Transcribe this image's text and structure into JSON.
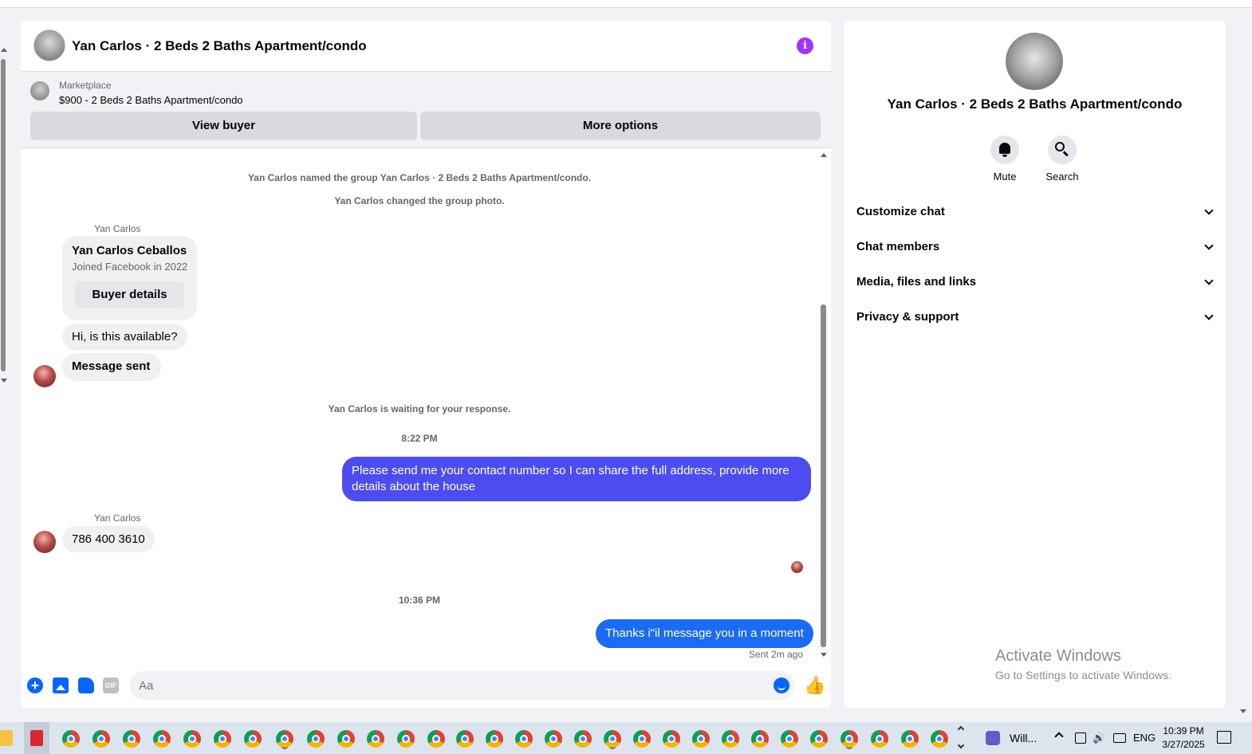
{
  "chat": {
    "title": "Yan Carlos · 2 Beds 2 Baths Apartment/condo",
    "info_icon": "info-icon",
    "marketplace": {
      "label": "Marketplace",
      "listing": "$900 - 2 Beds 2 Baths Apartment/condo",
      "view_buyer": "View buyer",
      "more_options": "More options"
    },
    "system": {
      "named": "Yan Carlos named the group Yan Carlos · 2 Beds 2 Baths Apartment/condo.",
      "photo": "Yan Carlos changed the group photo.",
      "waiting": "Yan Carlos is waiting for your response."
    },
    "sender_name": "Yan Carlos",
    "buyer_card": {
      "name": "Yan Carlos Ceballos",
      "joined": "Joined Facebook in 2022",
      "details_button": "Buyer details"
    },
    "messages": {
      "m1": "Hi, is this available?",
      "m2": "Message sent",
      "time1": "8:22 PM",
      "m3": "Please send me your contact number so I can share the full address, provide more details about the house",
      "m4": "786 400 3610",
      "time2": "10:36 PM",
      "m5": "Thanks i\"il message you in a moment",
      "status": "Sent 2m ago"
    },
    "composer": {
      "placeholder": "Aa"
    }
  },
  "side": {
    "title": "Yan Carlos · 2 Beds 2 Baths Apartment/condo",
    "mute": "Mute",
    "search": "Search",
    "sections": [
      "Customize chat",
      "Chat members",
      "Media, files and links",
      "Privacy & support"
    ]
  },
  "watermark": {
    "line1": "Activate Windows",
    "line2": "Go to Settings to activate Windows."
  },
  "taskbar": {
    "app_label": "Will...",
    "lang": "ENG",
    "time": "10:39 PM",
    "date": "3/27/2025"
  },
  "colors": {
    "accent_blue": "#0866ff",
    "bubble_purple": "#4c4cf0",
    "info_purple": "#a033ff"
  }
}
